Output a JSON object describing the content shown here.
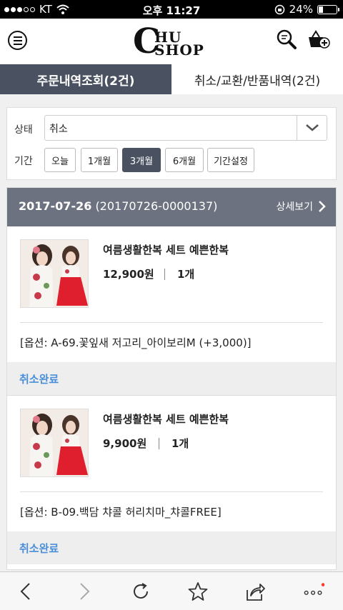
{
  "status_bar": {
    "carrier": "KT",
    "time": "오후 11:27",
    "battery": "24%",
    "battery_level": 0.24
  },
  "header": {
    "logo_big": "C",
    "logo_top": "HU",
    "logo_bottom": "SHOP"
  },
  "tabs": [
    {
      "label": "주문내역조회(2건)",
      "active": true
    },
    {
      "label": "취소/교환/반품내역(2건)",
      "active": false
    }
  ],
  "filter": {
    "status_label": "상태",
    "status_value": "취소",
    "period_label": "기간",
    "periods": [
      {
        "label": "오늘",
        "active": false
      },
      {
        "label": "1개월",
        "active": false
      },
      {
        "label": "3개월",
        "active": true
      },
      {
        "label": "6개월",
        "active": false
      },
      {
        "label": "기간설정",
        "active": false
      }
    ]
  },
  "order": {
    "date": "2017-07-26",
    "number": "(20170726-0000137)",
    "detail_label": "상세보기",
    "items": [
      {
        "name": "여름생활한복 세트 예쁜한복",
        "price": "12,900원",
        "qty": "1개",
        "option": "[옵션: A-69.꽃잎새 저고리_아이보리M (+3,000)]",
        "status": "취소완료"
      },
      {
        "name": "여름생활한복 세트 예쁜한복",
        "price": "9,900원",
        "qty": "1개",
        "option": "[옵션: B-09.백담 챠콜 허리치마_챠콜FREE]",
        "status": "취소완료"
      }
    ]
  },
  "colors": {
    "accent_dark": "#4a5161",
    "order_header": "#6d7280",
    "status_blue": "#4a8fd8",
    "notification_dot": "#ff3b30"
  }
}
